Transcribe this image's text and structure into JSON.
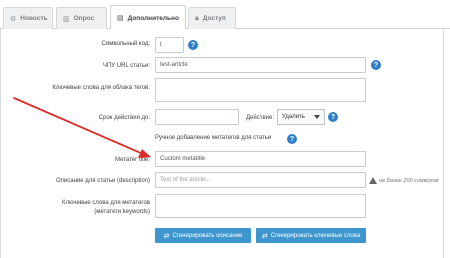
{
  "tabs": [
    {
      "label": "Новость",
      "icon": "gear-icon"
    },
    {
      "label": "Опрос",
      "icon": "chart-icon"
    },
    {
      "label": "Дополнительно",
      "icon": "list-icon"
    },
    {
      "label": "Доступ",
      "icon": "lock-icon"
    }
  ],
  "active_tab": "Дополнительно",
  "form": {
    "symbol_code": {
      "label": "Символьный код:",
      "value": "t"
    },
    "cpu_url": {
      "label": "ЧПУ URL статьи:",
      "value": "test-article"
    },
    "tag_keywords": {
      "label": "Ключевые слова для облака тегов:",
      "value": ""
    },
    "action_period": {
      "label": "Срок действия до:",
      "value": ""
    },
    "action": {
      "label": "Действие:",
      "selected": "Удалить"
    },
    "meta_section_title": "Ручное добавление метатегов для статьи",
    "meta_title": {
      "label": "Метатег title:",
      "value": "Custom metatitle"
    },
    "description": {
      "label": "Описание для статьи (description)",
      "placeholder": "Text of the article...",
      "note": "не более 200 символов"
    },
    "keywords": {
      "label_line1": "Ключевые слова для метатегов",
      "label_line2": "(метатеги keywords)",
      "value": ""
    }
  },
  "buttons": {
    "generate_description": "Сгенерировать описание",
    "generate_keywords": "Сгенерировать ключевые слова"
  },
  "colors": {
    "accent": "#3e96cf",
    "help": "#2f7fc8",
    "arrow": "#e02b2b"
  }
}
